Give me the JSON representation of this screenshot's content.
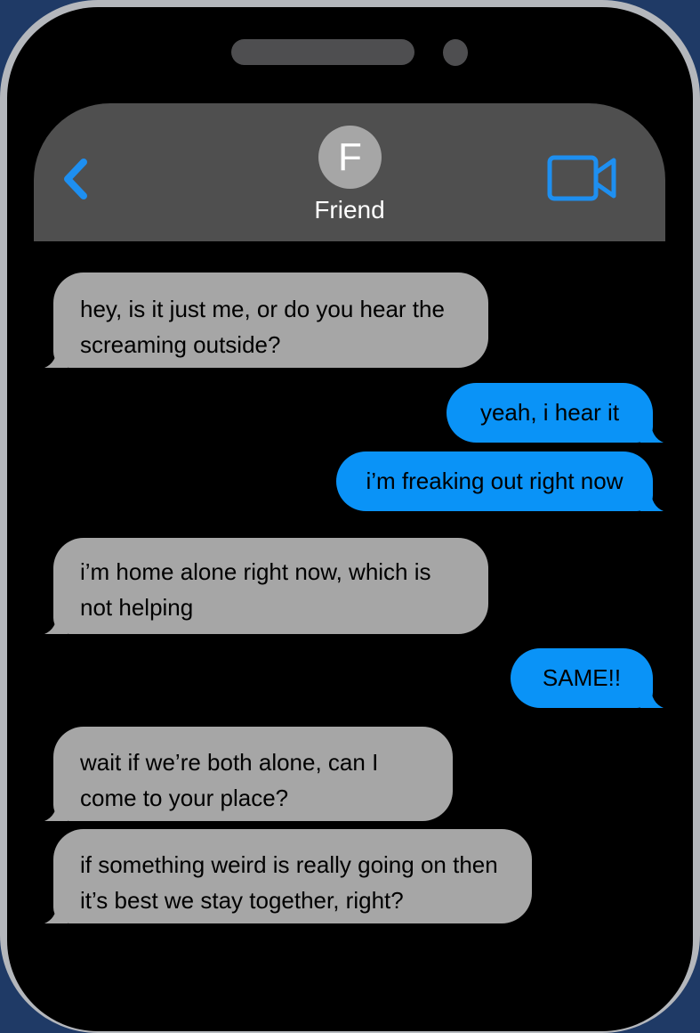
{
  "header": {
    "avatar_initial": "F",
    "contact_name": "Friend",
    "back_icon": "chevron-left-icon",
    "video_icon": "video-camera-icon",
    "accent_color": "#1e8ff0"
  },
  "messages": [
    {
      "sender": "friend",
      "text": "hey, is it just me, or do you hear the screaming outside?"
    },
    {
      "sender": "me",
      "text": "yeah, i hear it"
    },
    {
      "sender": "me",
      "text": "i’m freaking out right now"
    },
    {
      "sender": "friend",
      "text": "i’m home alone right now, which is not helping"
    },
    {
      "sender": "me",
      "text": "SAME!!"
    },
    {
      "sender": "friend",
      "text": "wait if we’re both alone, can I come to your place?"
    },
    {
      "sender": "friend",
      "text": "if something weird is really going on then it’s best we stay together, right?"
    }
  ],
  "colors": {
    "incoming_bubble": "#a6a6a6",
    "outgoing_bubble": "#0a93f7",
    "header_bg": "#4f4f4f",
    "screen_bg": "#000000"
  }
}
